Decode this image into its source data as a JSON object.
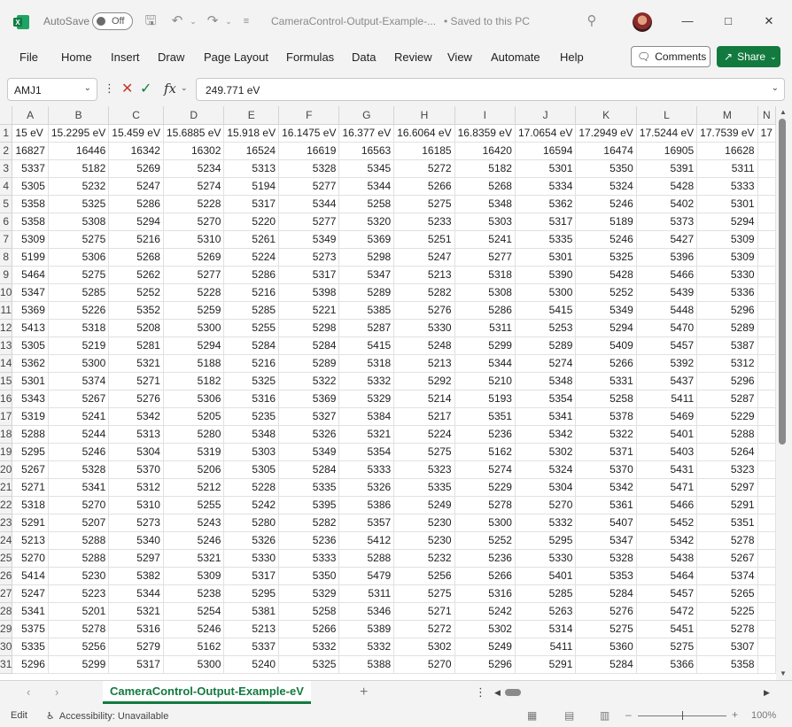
{
  "titlebar": {
    "autosave_label": "AutoSave",
    "autosave_state": "Off",
    "doc_title": "CameraControl-Output-Example-...",
    "saved_status": "• Saved to this PC",
    "icons": [
      "excel-logo",
      "save-icon",
      "undo-icon",
      "redo-icon",
      "customize-icon",
      "search-icon",
      "minimize-icon",
      "maximize-icon",
      "close-icon"
    ]
  },
  "menu": {
    "items": [
      "File",
      "Home",
      "Insert",
      "Draw",
      "Page Layout",
      "Formulas",
      "Data",
      "Review",
      "View",
      "Automate",
      "Help"
    ],
    "comments_label": "Comments",
    "share_label": "Share"
  },
  "formula_bar": {
    "name_box": "AMJ1",
    "fx": "fx",
    "value": "249.771 eV"
  },
  "grid": {
    "columns": [
      "A",
      "B",
      "C",
      "D",
      "E",
      "F",
      "G",
      "H",
      "I",
      "J",
      "K",
      "L",
      "M",
      "N"
    ],
    "row1": [
      "15 eV",
      "15.2295 eV",
      "15.459 eV",
      "15.6885 eV",
      "15.918 eV",
      "16.1475 eV",
      "16.377 eV",
      "16.6064 eV",
      "16.8359 eV",
      "17.0654 eV",
      "17.2949 eV",
      "17.5244 eV",
      "17.7539 eV",
      "17"
    ],
    "rows": [
      [
        "16827",
        "16446",
        "16342",
        "16302",
        "16524",
        "16619",
        "16563",
        "16185",
        "16420",
        "16594",
        "16474",
        "16905",
        "16628"
      ],
      [
        "5337",
        "5182",
        "5269",
        "5234",
        "5313",
        "5328",
        "5345",
        "5272",
        "5182",
        "5301",
        "5350",
        "5391",
        "5311"
      ],
      [
        "5305",
        "5232",
        "5247",
        "5274",
        "5194",
        "5277",
        "5344",
        "5266",
        "5268",
        "5334",
        "5324",
        "5428",
        "5333"
      ],
      [
        "5358",
        "5325",
        "5286",
        "5228",
        "5317",
        "5344",
        "5258",
        "5275",
        "5348",
        "5362",
        "5246",
        "5402",
        "5301"
      ],
      [
        "5358",
        "5308",
        "5294",
        "5270",
        "5220",
        "5277",
        "5320",
        "5233",
        "5303",
        "5317",
        "5189",
        "5373",
        "5294"
      ],
      [
        "5309",
        "5275",
        "5216",
        "5310",
        "5261",
        "5349",
        "5369",
        "5251",
        "5241",
        "5335",
        "5246",
        "5427",
        "5309"
      ],
      [
        "5199",
        "5306",
        "5268",
        "5269",
        "5224",
        "5273",
        "5298",
        "5247",
        "5277",
        "5301",
        "5325",
        "5396",
        "5309"
      ],
      [
        "5464",
        "5275",
        "5262",
        "5277",
        "5286",
        "5317",
        "5347",
        "5213",
        "5318",
        "5390",
        "5428",
        "5466",
        "5330"
      ],
      [
        "5347",
        "5285",
        "5252",
        "5228",
        "5216",
        "5398",
        "5289",
        "5282",
        "5308",
        "5300",
        "5252",
        "5439",
        "5336"
      ],
      [
        "5369",
        "5226",
        "5352",
        "5259",
        "5285",
        "5221",
        "5385",
        "5276",
        "5286",
        "5415",
        "5349",
        "5448",
        "5296"
      ],
      [
        "5413",
        "5318",
        "5208",
        "5300",
        "5255",
        "5298",
        "5287",
        "5330",
        "5311",
        "5253",
        "5294",
        "5470",
        "5289"
      ],
      [
        "5305",
        "5219",
        "5281",
        "5294",
        "5284",
        "5284",
        "5415",
        "5248",
        "5299",
        "5289",
        "5409",
        "5457",
        "5387"
      ],
      [
        "5362",
        "5300",
        "5321",
        "5188",
        "5216",
        "5289",
        "5318",
        "5213",
        "5344",
        "5274",
        "5266",
        "5392",
        "5312"
      ],
      [
        "5301",
        "5374",
        "5271",
        "5182",
        "5325",
        "5322",
        "5332",
        "5292",
        "5210",
        "5348",
        "5331",
        "5437",
        "5296"
      ],
      [
        "5343",
        "5267",
        "5276",
        "5306",
        "5316",
        "5369",
        "5329",
        "5214",
        "5193",
        "5354",
        "5258",
        "5411",
        "5287"
      ],
      [
        "5319",
        "5241",
        "5342",
        "5205",
        "5235",
        "5327",
        "5384",
        "5217",
        "5351",
        "5341",
        "5378",
        "5469",
        "5229"
      ],
      [
        "5288",
        "5244",
        "5313",
        "5280",
        "5348",
        "5326",
        "5321",
        "5224",
        "5236",
        "5342",
        "5322",
        "5401",
        "5288"
      ],
      [
        "5295",
        "5246",
        "5304",
        "5319",
        "5303",
        "5349",
        "5354",
        "5275",
        "5162",
        "5302",
        "5371",
        "5403",
        "5264"
      ],
      [
        "5267",
        "5328",
        "5370",
        "5206",
        "5305",
        "5284",
        "5333",
        "5323",
        "5274",
        "5324",
        "5370",
        "5431",
        "5323"
      ],
      [
        "5271",
        "5341",
        "5312",
        "5212",
        "5228",
        "5335",
        "5326",
        "5335",
        "5229",
        "5304",
        "5342",
        "5471",
        "5297"
      ],
      [
        "5318",
        "5270",
        "5310",
        "5255",
        "5242",
        "5395",
        "5386",
        "5249",
        "5278",
        "5270",
        "5361",
        "5466",
        "5291"
      ],
      [
        "5291",
        "5207",
        "5273",
        "5243",
        "5280",
        "5282",
        "5357",
        "5230",
        "5300",
        "5332",
        "5407",
        "5452",
        "5351"
      ],
      [
        "5213",
        "5288",
        "5340",
        "5246",
        "5326",
        "5236",
        "5412",
        "5230",
        "5252",
        "5295",
        "5347",
        "5342",
        "5278"
      ],
      [
        "5270",
        "5288",
        "5297",
        "5321",
        "5330",
        "5333",
        "5288",
        "5232",
        "5236",
        "5330",
        "5328",
        "5438",
        "5267"
      ],
      [
        "5414",
        "5230",
        "5382",
        "5309",
        "5317",
        "5350",
        "5479",
        "5256",
        "5266",
        "5401",
        "5353",
        "5464",
        "5374"
      ],
      [
        "5247",
        "5223",
        "5344",
        "5238",
        "5295",
        "5329",
        "5311",
        "5275",
        "5316",
        "5285",
        "5284",
        "5457",
        "5265"
      ],
      [
        "5341",
        "5201",
        "5321",
        "5254",
        "5381",
        "5258",
        "5346",
        "5271",
        "5242",
        "5263",
        "5276",
        "5472",
        "5225"
      ],
      [
        "5375",
        "5278",
        "5316",
        "5246",
        "5213",
        "5266",
        "5389",
        "5272",
        "5302",
        "5314",
        "5275",
        "5451",
        "5278"
      ],
      [
        "5335",
        "5256",
        "5279",
        "5162",
        "5337",
        "5332",
        "5332",
        "5302",
        "5249",
        "5411",
        "5360",
        "5275",
        "5307"
      ],
      [
        "5296",
        "5299",
        "5317",
        "5300",
        "5240",
        "5325",
        "5388",
        "5270",
        "5296",
        "5291",
        "5284",
        "5366",
        "5358"
      ]
    ]
  },
  "tabs": {
    "sheet_name": "CameraControl-Output-Example-eV"
  },
  "statusbar": {
    "mode": "Edit",
    "accessibility": "Accessibility: Unavailable",
    "zoom": "100%"
  }
}
